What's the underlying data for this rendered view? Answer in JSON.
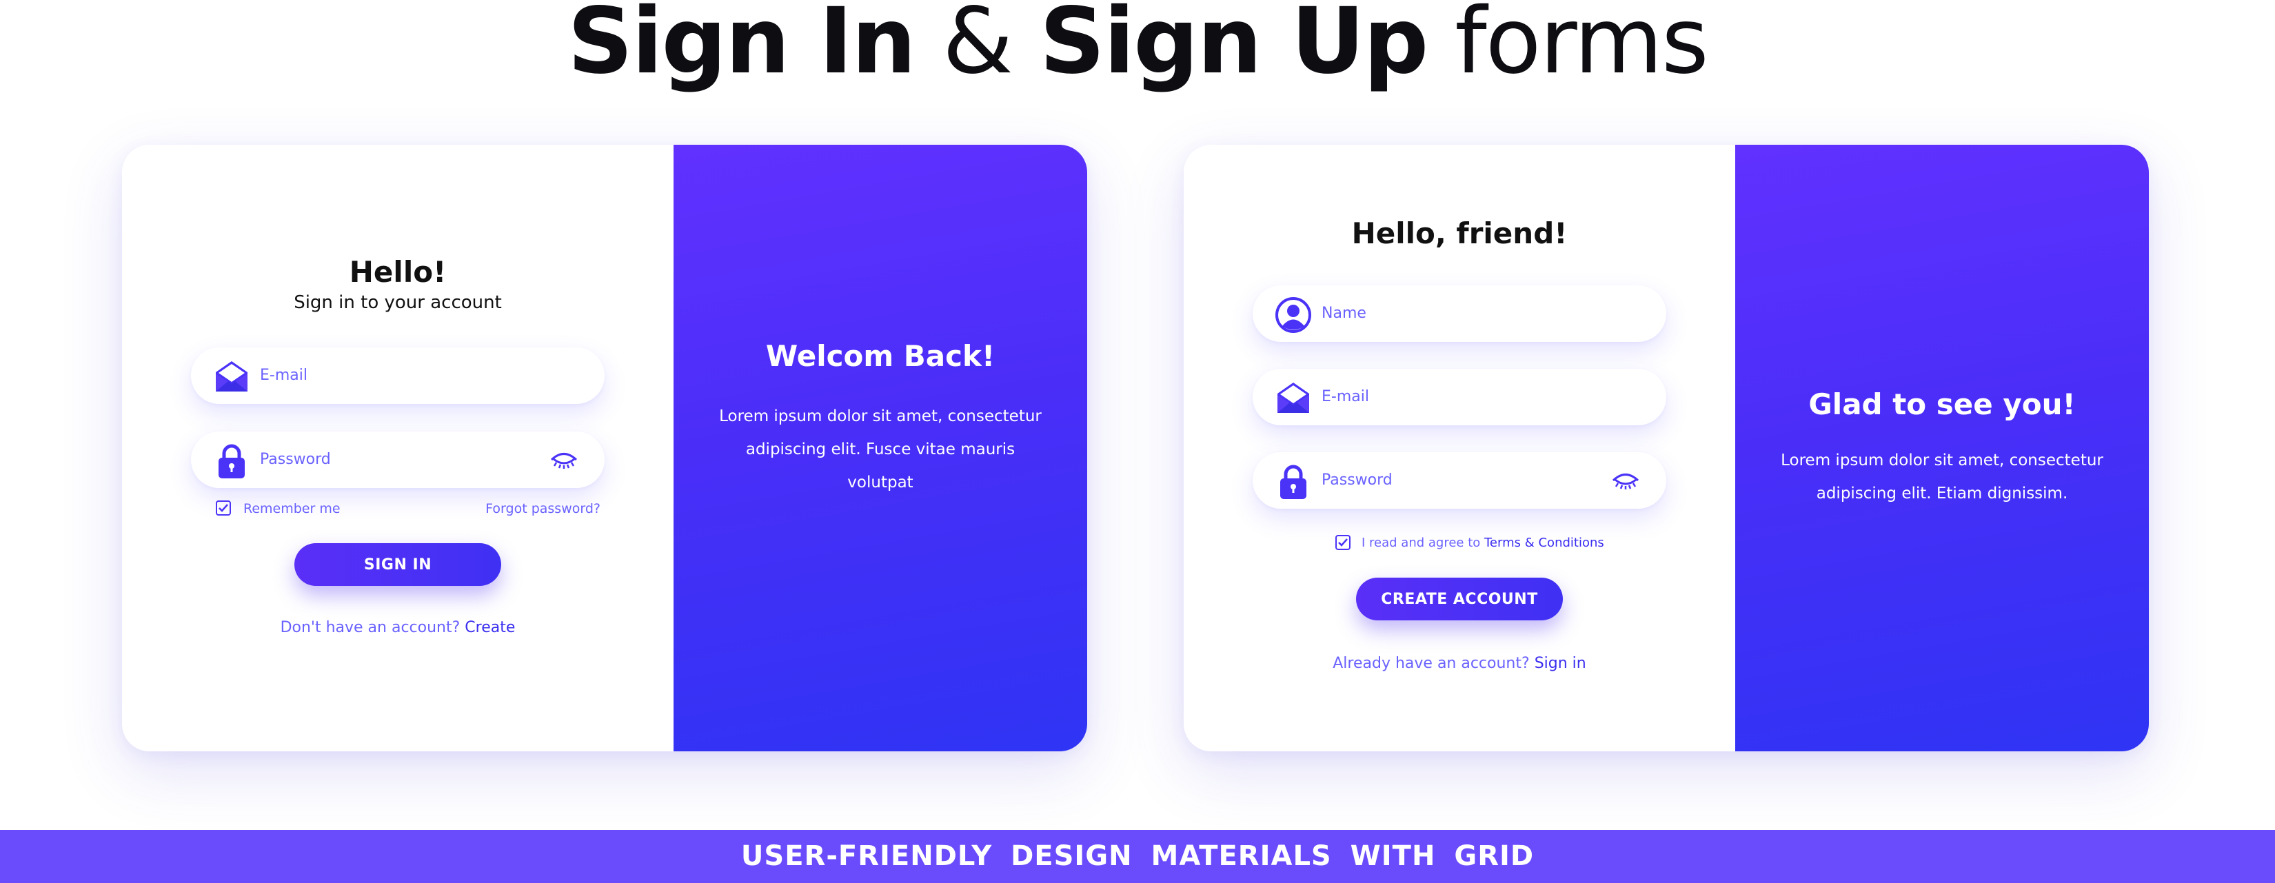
{
  "page": {
    "title_part1": "Sign In",
    "title_amp": " & ",
    "title_part2": "Sign Up",
    "title_part3": " forms"
  },
  "signin": {
    "heading": "Hello!",
    "subheading": "Sign in to your account",
    "email_placeholder": "E-mail",
    "password_placeholder": "Password",
    "remember_label": "Remember me",
    "forgot_label": "Forgot password?",
    "button_label": "SIGN IN",
    "prompt_text": "Don't have an account? ",
    "prompt_link": "Create",
    "side_title": "Welcom Back!",
    "side_text": "Lorem ipsum dolor sit amet, consectetur adipiscing elit. Fusce vitae mauris volutpat"
  },
  "signup": {
    "heading": "Hello, friend!",
    "name_placeholder": "Name",
    "email_placeholder": "E-mail",
    "password_placeholder": "Password",
    "agree_text": "I read and agree to ",
    "agree_link": "Terms & Conditions",
    "button_label": "CREATE ACCOUNT",
    "prompt_text": "Already have an account? ",
    "prompt_link": "Sign in",
    "side_title": "Glad to see you!",
    "side_text": "Lorem ipsum dolor sit amet, consectetur adipiscing elit. Etiam dignissim."
  },
  "banner": {
    "text": "USER-FRIENDLY DESIGN MATERIALS WITH GRID"
  },
  "colors": {
    "accent": "#4a33f7",
    "gradient_start": "#6131ff",
    "gradient_end": "#2f34f4",
    "placeholder": "#6a62ff",
    "banner": "#6a4cfc"
  },
  "icons": [
    "envelope-icon",
    "lock-icon",
    "eye-icon",
    "check-icon",
    "user-icon"
  ]
}
